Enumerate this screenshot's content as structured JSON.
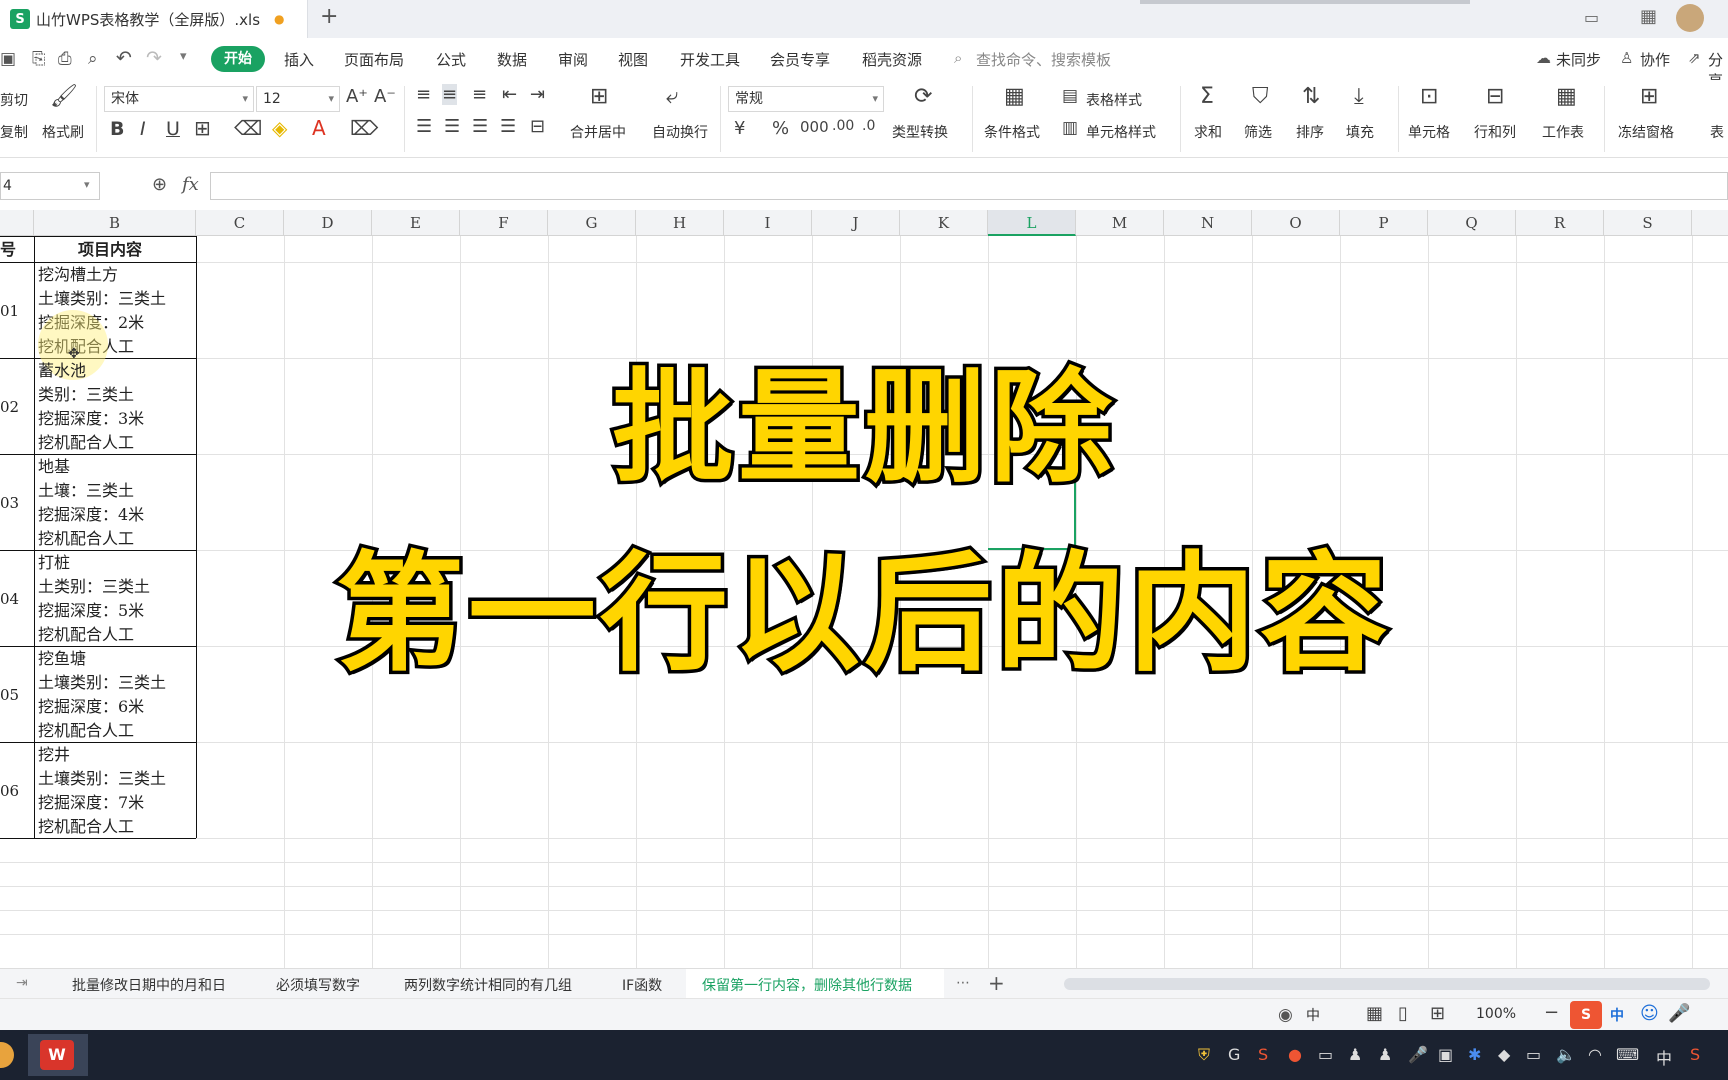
{
  "window": {
    "doc_tab_title": "山竹WPS表格教学（全屏版）.xls",
    "new_tab": "+"
  },
  "menu": {
    "tabs": [
      "开始",
      "插入",
      "页面布局",
      "公式",
      "数据",
      "审阅",
      "视图",
      "开发工具",
      "会员专享",
      "稻壳资源"
    ],
    "search_placeholder": "查找命令、搜索模板",
    "sync": "未同步",
    "collab": "协作",
    "share": "分享"
  },
  "ribbon": {
    "cut": "剪切",
    "copy": "复制",
    "format_painter": "格式刷",
    "font_name": "宋体",
    "font_size": "12",
    "merge_center": "合并居中",
    "wrap_text": "自动换行",
    "number_format": "常规",
    "type_convert": "类型转换",
    "conditional_format": "条件格式",
    "table_style": "表格样式",
    "cell_style": "单元格样式",
    "sum": "求和",
    "filter": "筛选",
    "sort": "排序",
    "fill": "填充",
    "cell": "单元格",
    "row_col": "行和列",
    "worksheet": "工作表",
    "freeze": "冻结窗格",
    "table_tool": "表"
  },
  "formula_bar": {
    "name_box": "4",
    "fx": "fx"
  },
  "columns": [
    "B",
    "C",
    "D",
    "E",
    "F",
    "G",
    "H",
    "I",
    "J",
    "K",
    "L",
    "M",
    "N",
    "O",
    "P",
    "Q",
    "R",
    "S"
  ],
  "selected_column": "L",
  "table": {
    "header_a": "号",
    "header_b": "项目内容",
    "rows": [
      {
        "num": "01",
        "lines": [
          "挖沟槽土方",
          "土壤类别：三类土",
          "挖掘深度：2米",
          "挖机配合人工"
        ]
      },
      {
        "num": "02",
        "lines": [
          "蓄水池",
          "类别：三类土",
          "挖掘深度：3米",
          "挖机配合人工"
        ]
      },
      {
        "num": "03",
        "lines": [
          "地基",
          "土壤：三类土",
          "挖掘深度：4米",
          "挖机配合人工"
        ]
      },
      {
        "num": "04",
        "lines": [
          "打桩",
          "土类别：三类土",
          "挖掘深度：5米",
          "挖机配合人工"
        ]
      },
      {
        "num": "05",
        "lines": [
          "挖鱼塘",
          "土壤类别：三类土",
          "挖掘深度：6米",
          "挖机配合人工"
        ]
      },
      {
        "num": "06",
        "lines": [
          "挖井",
          "土壤类别：三类土",
          "挖掘深度：7米",
          "挖机配合人工"
        ]
      }
    ]
  },
  "overlay": {
    "line1": "批量删除",
    "line2": "第一行以后的内容"
  },
  "sheet_tabs": [
    "批量修改日期中的月和日",
    "必须填写数字",
    "两列数字统计相同的有几组",
    "IF函数",
    "保留第一行内容，删除其他行数据"
  ],
  "active_sheet": "保留第一行内容，删除其他行数据",
  "status": {
    "zoom": "100%",
    "ime": "中"
  }
}
